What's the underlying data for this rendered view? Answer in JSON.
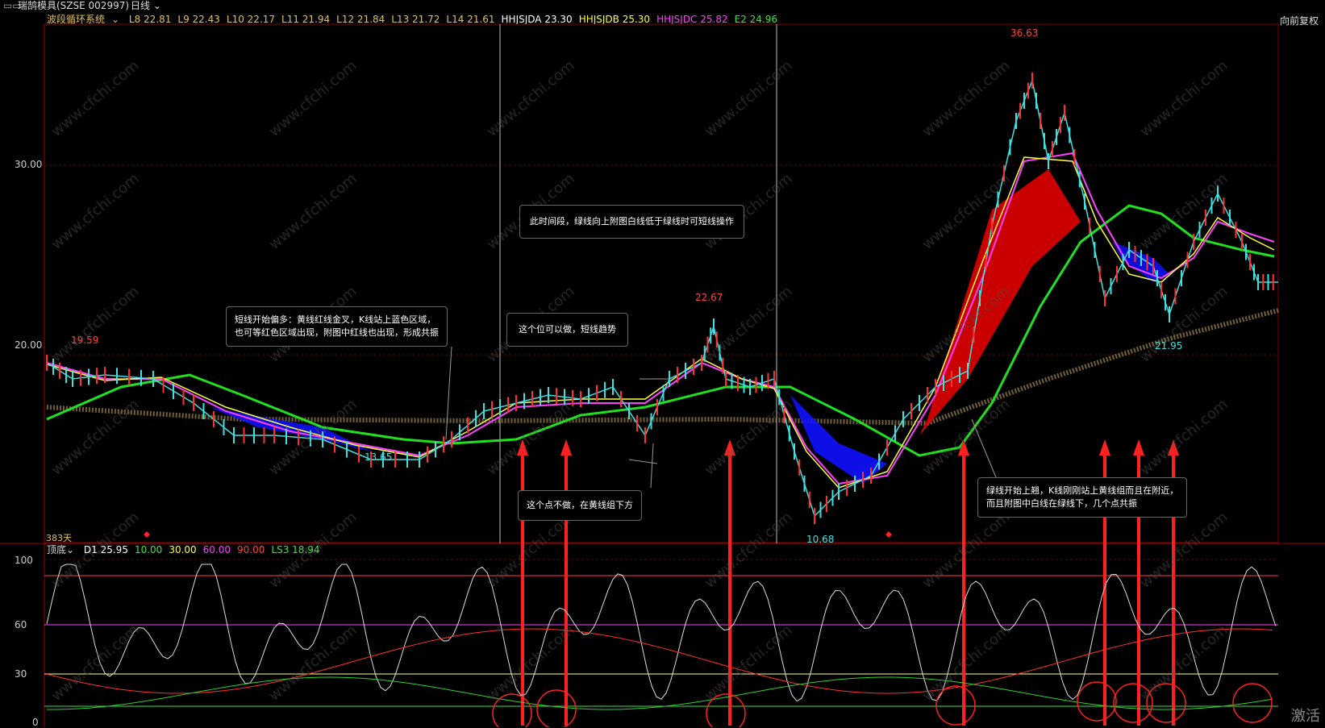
{
  "titlebar": {
    "symbol": "瑞鹄模具(SZSE 002997)",
    "period": "日线"
  },
  "main_header": {
    "indicator": "波段循环系统",
    "values": [
      {
        "label": "L8 22.81",
        "color": "#e0c060"
      },
      {
        "label": "L9 22.43",
        "color": "#e0c060"
      },
      {
        "label": "L10 22.17",
        "color": "#e0c060"
      },
      {
        "label": "L11 21.94",
        "color": "#e0c060"
      },
      {
        "label": "L12 21.84",
        "color": "#e0c060"
      },
      {
        "label": "L13 21.72",
        "color": "#e0c060"
      },
      {
        "label": "L14 21.61",
        "color": "#e0c060"
      },
      {
        "label": "HHJSJDA 23.30",
        "color": "#ffffff"
      },
      {
        "label": "HHJSJDB 25.30",
        "color": "#ffff40"
      },
      {
        "label": "HHJSJDC 25.82",
        "color": "#ff40ff"
      },
      {
        "label": "E2 24.96",
        "color": "#40e040"
      }
    ],
    "adjust_label": "向前复权"
  },
  "y_axis_main": [
    "30.00",
    "20.00"
  ],
  "price_labels": {
    "p1": "19.59",
    "p2": "13.65",
    "p3": "22.67",
    "p4": "10.68",
    "p5": "36.63",
    "p6": "21.95"
  },
  "days_label": "383天",
  "annotations": {
    "a1_line1": "短线开始偏多：黄线红线金叉，K线站上蓝色区域，",
    "a1_line2": "也可等红色区域出现，附图中红线也出现，形成共振",
    "a2": "这个位可以做，短线趋势",
    "a3": "此时间段，绿线向上附图白线低于绿线时可短线操作",
    "a4": "这个点不做，在黄线组下方",
    "a5_line1": "绿线开始上翘，K线刚刚站上黄线组而且在附近，",
    "a5_line2": "而且附图中白线在绿线下，几个点共振"
  },
  "sub_header": {
    "indicator": "顶底",
    "values": [
      {
        "label": "D1 25.95",
        "color": "#ffffff"
      },
      {
        "label": "10.00",
        "color": "#40e040"
      },
      {
        "label": "30.00",
        "color": "#ffff40"
      },
      {
        "label": "60.00",
        "color": "#ff40ff"
      },
      {
        "label": "90.00",
        "color": "#ff4040"
      },
      {
        "label": "LS3 18.94",
        "color": "#40e040"
      }
    ]
  },
  "y_axis_sub": [
    "100",
    "60",
    "30",
    "0"
  ],
  "watermark": "www.cfchi.com",
  "corner_text": "激活",
  "colors": {
    "up": "#ff3030",
    "down": "#40e0e0",
    "green": "#20e020",
    "yellow": "#ffff40",
    "magenta": "#ff40ff",
    "red": "#e00000",
    "blue": "#1010ff"
  }
}
